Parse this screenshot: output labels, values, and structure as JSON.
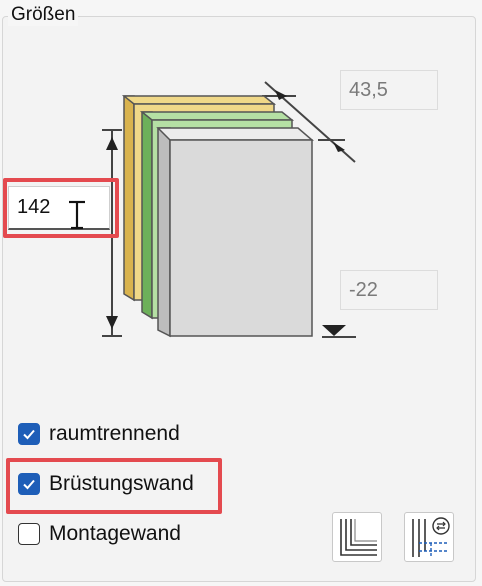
{
  "group": {
    "title": "Größen"
  },
  "dimensions": {
    "height_value": "142",
    "thickness_value": "43,5",
    "offset_value": "-22"
  },
  "checkboxes": [
    {
      "label": "raumtrennend",
      "checked": true
    },
    {
      "label": "Brüstungswand",
      "checked": true
    },
    {
      "label": "Montagewand",
      "checked": false
    }
  ],
  "colors": {
    "accent": "#1e5eb8",
    "highlight": "#e44a4f",
    "layer_yellow": "#e6c97a",
    "layer_green": "#8fcf7a",
    "layer_gray": "#dcdcdc"
  },
  "icons": {
    "cursor": "text-cursor-icon",
    "tool1": "wall-layers-icon",
    "tool2": "layer-settings-icon"
  }
}
